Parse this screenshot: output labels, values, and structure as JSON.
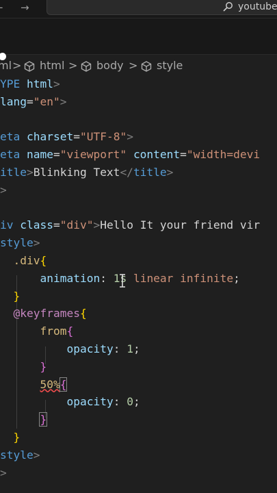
{
  "titlebar": {
    "back_icon": "←",
    "forward_icon": "→",
    "search_text": "youtube"
  },
  "breadcrumb": {
    "items": [
      "ml",
      "html",
      "body",
      "style"
    ],
    "separator": ">"
  },
  "editor": {
    "lines": [
      {
        "segments": [
          {
            "t": "YPE ",
            "c": "tk-tag"
          },
          {
            "t": "html",
            "c": "tk-attr"
          },
          {
            "t": ">",
            "c": "tk-br"
          }
        ]
      },
      {
        "segments": [
          {
            "t": "lang",
            "c": "tk-attr"
          },
          {
            "t": "=",
            "c": "tk-eq"
          },
          {
            "t": "\"en\"",
            "c": "tk-str"
          },
          {
            "t": ">",
            "c": "tk-br"
          }
        ]
      },
      {
        "segments": []
      },
      {
        "segments": [
          {
            "t": "eta ",
            "c": "tk-tag"
          },
          {
            "t": "charset",
            "c": "tk-attr"
          },
          {
            "t": "=",
            "c": "tk-eq"
          },
          {
            "t": "\"UTF-8\"",
            "c": "tk-str"
          },
          {
            "t": ">",
            "c": "tk-br"
          }
        ]
      },
      {
        "segments": [
          {
            "t": "eta ",
            "c": "tk-tag"
          },
          {
            "t": "name",
            "c": "tk-attr"
          },
          {
            "t": "=",
            "c": "tk-eq"
          },
          {
            "t": "\"viewport\"",
            "c": "tk-str"
          },
          {
            "t": " ",
            "c": "tk-text"
          },
          {
            "t": "content",
            "c": "tk-attr"
          },
          {
            "t": "=",
            "c": "tk-eq"
          },
          {
            "t": "\"width=devi",
            "c": "tk-str"
          }
        ]
      },
      {
        "segments": [
          {
            "t": "itle",
            "c": "tk-tag"
          },
          {
            "t": ">",
            "c": "tk-br"
          },
          {
            "t": "Blinking Text",
            "c": "tk-text"
          },
          {
            "t": "</",
            "c": "tk-br"
          },
          {
            "t": "title",
            "c": "tk-tag"
          },
          {
            "t": ">",
            "c": "tk-br"
          }
        ]
      },
      {
        "segments": [
          {
            "t": ">",
            "c": "tk-br"
          }
        ]
      },
      {
        "segments": []
      },
      {
        "segments": [
          {
            "t": "iv ",
            "c": "tk-tag"
          },
          {
            "t": "class",
            "c": "tk-attr"
          },
          {
            "t": "=",
            "c": "tk-eq"
          },
          {
            "t": "\"div\"",
            "c": "tk-str"
          },
          {
            "t": ">",
            "c": "tk-br"
          },
          {
            "t": "Hello It your friend vir",
            "c": "tk-text"
          }
        ]
      },
      {
        "segments": [
          {
            "t": "style",
            "c": "tk-tag"
          },
          {
            "t": ">",
            "c": "tk-br"
          }
        ]
      },
      {
        "segments": [
          {
            "t": "  .div",
            "c": "tk-sel"
          },
          {
            "t": "{",
            "c": "tk-brace"
          }
        ]
      },
      {
        "segments": [
          {
            "t": "      ",
            "c": "tk-text"
          },
          {
            "t": "animation",
            "c": "tk-prop"
          },
          {
            "t": ": ",
            "c": "tk-punct"
          },
          {
            "t": "1s",
            "c": "tk-num"
          },
          {
            "t": " linear infinite",
            "c": "tk-val"
          },
          {
            "t": ";",
            "c": "tk-punct"
          }
        ]
      },
      {
        "segments": [
          {
            "t": "  ",
            "c": "tk-text"
          },
          {
            "t": "}",
            "c": "tk-brace"
          }
        ]
      },
      {
        "segments": [
          {
            "t": "  ",
            "c": "tk-text"
          },
          {
            "t": "@keyframes",
            "c": "tk-at"
          },
          {
            "t": "{",
            "c": "tk-brace"
          }
        ]
      },
      {
        "segments": [
          {
            "t": "      ",
            "c": "tk-text"
          },
          {
            "t": "from",
            "c": "tk-sel"
          },
          {
            "t": "{",
            "c": "tk-brace2"
          }
        ]
      },
      {
        "segments": [
          {
            "t": "          ",
            "c": "tk-text"
          },
          {
            "t": "opacity",
            "c": "tk-prop"
          },
          {
            "t": ": ",
            "c": "tk-punct"
          },
          {
            "t": "1",
            "c": "tk-num"
          },
          {
            "t": ";",
            "c": "tk-punct"
          }
        ]
      },
      {
        "segments": [
          {
            "t": "      ",
            "c": "tk-text"
          },
          {
            "t": "}",
            "c": "tk-brace2"
          }
        ]
      },
      {
        "segments": [
          {
            "t": "      ",
            "c": "tk-text"
          },
          {
            "t": "50%",
            "c": "tk-sel squiggle"
          },
          {
            "t": "{",
            "c": "tk-brace2 brace-box"
          }
        ]
      },
      {
        "segments": [
          {
            "t": "          ",
            "c": "tk-text"
          },
          {
            "t": "opacity",
            "c": "tk-prop"
          },
          {
            "t": ": ",
            "c": "tk-punct"
          },
          {
            "t": "0",
            "c": "tk-num"
          },
          {
            "t": ";",
            "c": "tk-punct"
          }
        ]
      },
      {
        "segments": [
          {
            "t": "      ",
            "c": "tk-text"
          },
          {
            "t": "}",
            "c": "tk-brace2 brace-box"
          }
        ]
      },
      {
        "segments": [
          {
            "t": "  ",
            "c": "tk-text"
          },
          {
            "t": "}",
            "c": "tk-brace"
          }
        ]
      },
      {
        "segments": [
          {
            "t": "style",
            "c": "tk-tag"
          },
          {
            "t": ">",
            "c": "tk-br"
          }
        ]
      },
      {
        "segments": [
          {
            "t": ">",
            "c": "tk-br"
          }
        ]
      }
    ]
  },
  "colors": {
    "background": "#1f1f1f",
    "tag": "#569cd6",
    "attribute": "#9cdcfe",
    "string": "#ce9178",
    "keyword": "#c586c0",
    "number": "#b5cea8"
  }
}
